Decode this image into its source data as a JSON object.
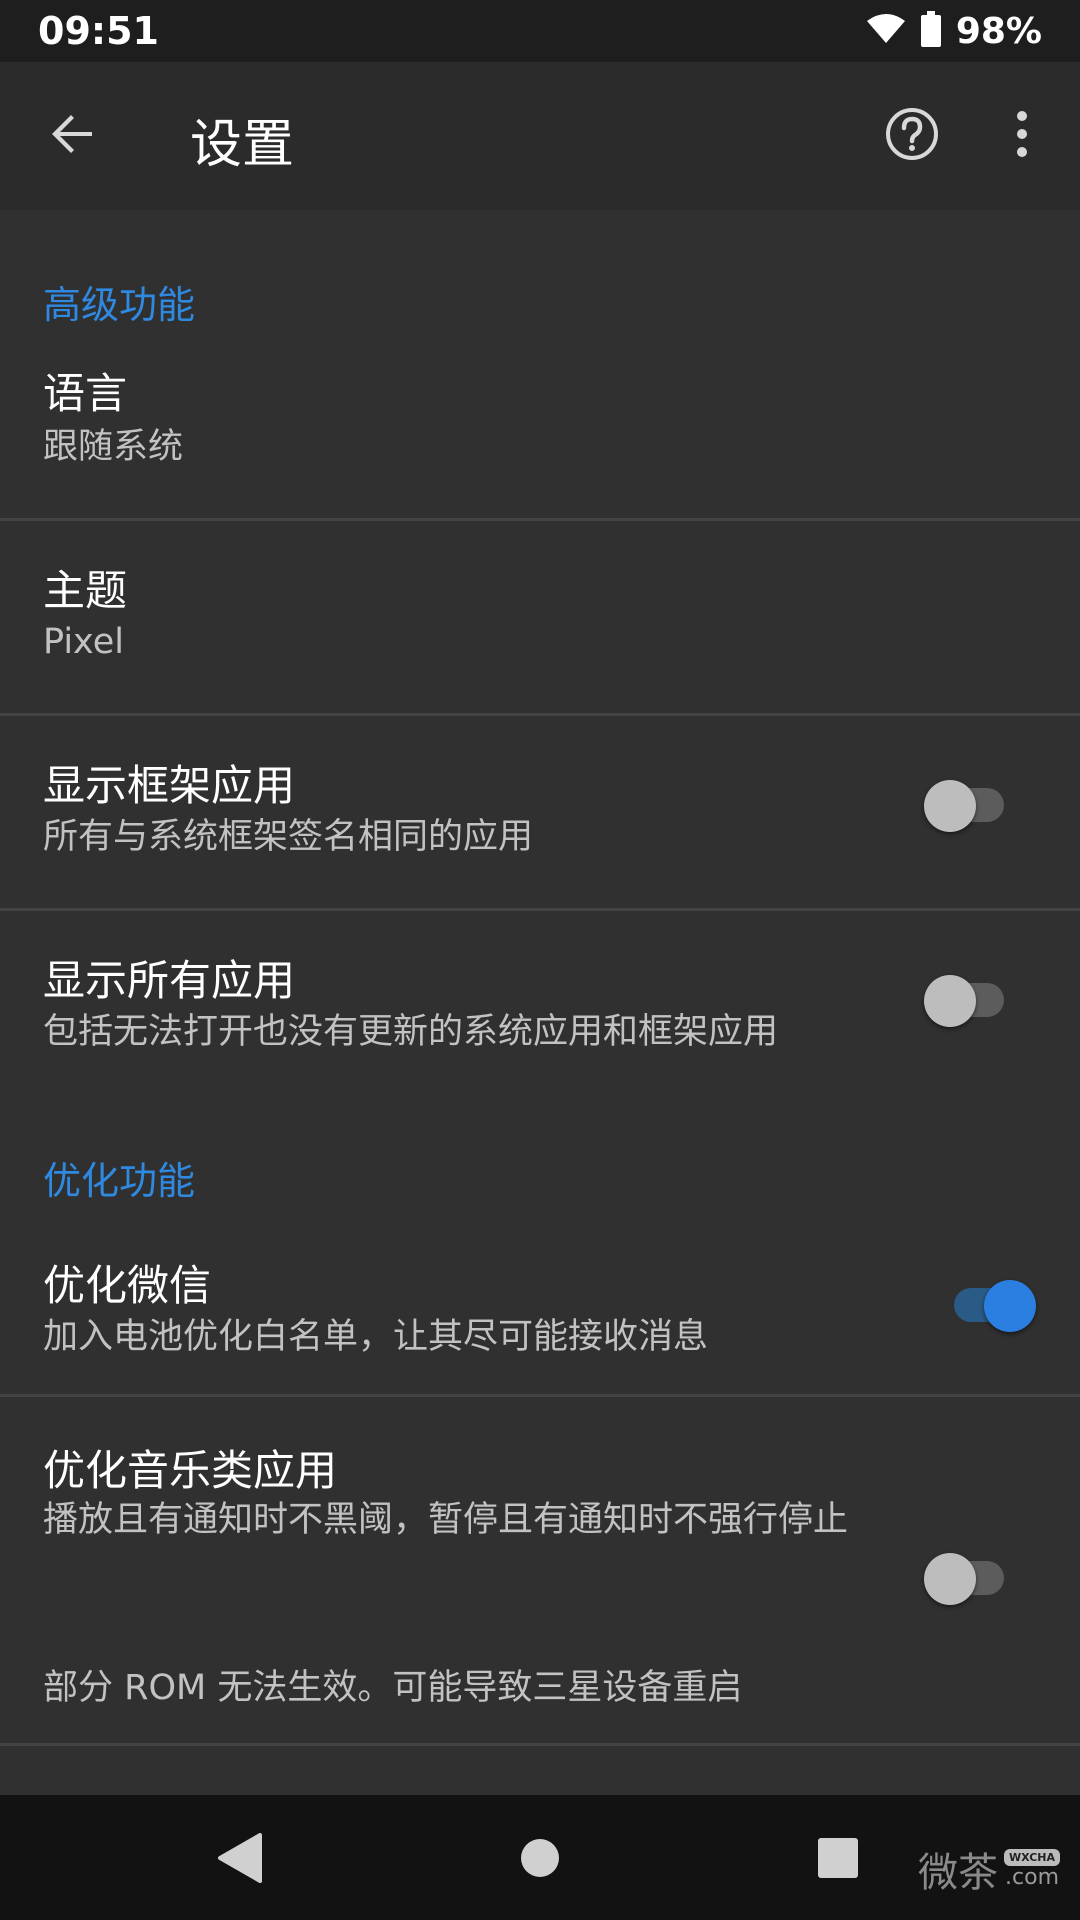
{
  "status_bar": {
    "time": "09:51",
    "battery": "98%",
    "icons": [
      "wifi-icon",
      "battery-icon"
    ]
  },
  "toolbar": {
    "title": "设置",
    "back_icon": "arrow-back-icon",
    "help_icon": "help-circle-icon",
    "more_icon": "more-vert-icon"
  },
  "sections": [
    {
      "header": "高级功能"
    },
    {
      "header": "优化功能"
    }
  ],
  "prefs": {
    "language": {
      "title": "语言",
      "summary": "跟随系统"
    },
    "theme": {
      "title": "主题",
      "summary": "Pixel"
    },
    "show_framework": {
      "title": "显示框架应用",
      "summary": "所有与系统框架签名相同的应用",
      "checked": false
    },
    "show_all": {
      "title": "显示所有应用",
      "summary": "包括无法打开也没有更新的系统应用和框架应用",
      "checked": false
    },
    "optimize_wechat": {
      "title": "优化微信",
      "summary": "加入电池优化白名单，让其尽可能接收消息",
      "checked": true
    },
    "optimize_music": {
      "title": "优化音乐类应用",
      "summary": "播放且有通知时不黑阈，暂停且有通知时不强行停止",
      "checked": false,
      "footnote": "部分 ROM 无法生效。可能导致三星设备重启"
    }
  },
  "colors": {
    "accent": "#2f89e0",
    "switch_on": "#2a7fe1",
    "background": "#303030",
    "toolbar": "#2b2b2b"
  },
  "nav_bar": {
    "back_icon": "nav-back-icon",
    "home_icon": "nav-home-icon",
    "recents_icon": "nav-recents-icon"
  },
  "watermark": {
    "cn": "微茶",
    "badge": "WXCHA",
    "com": ".com"
  }
}
